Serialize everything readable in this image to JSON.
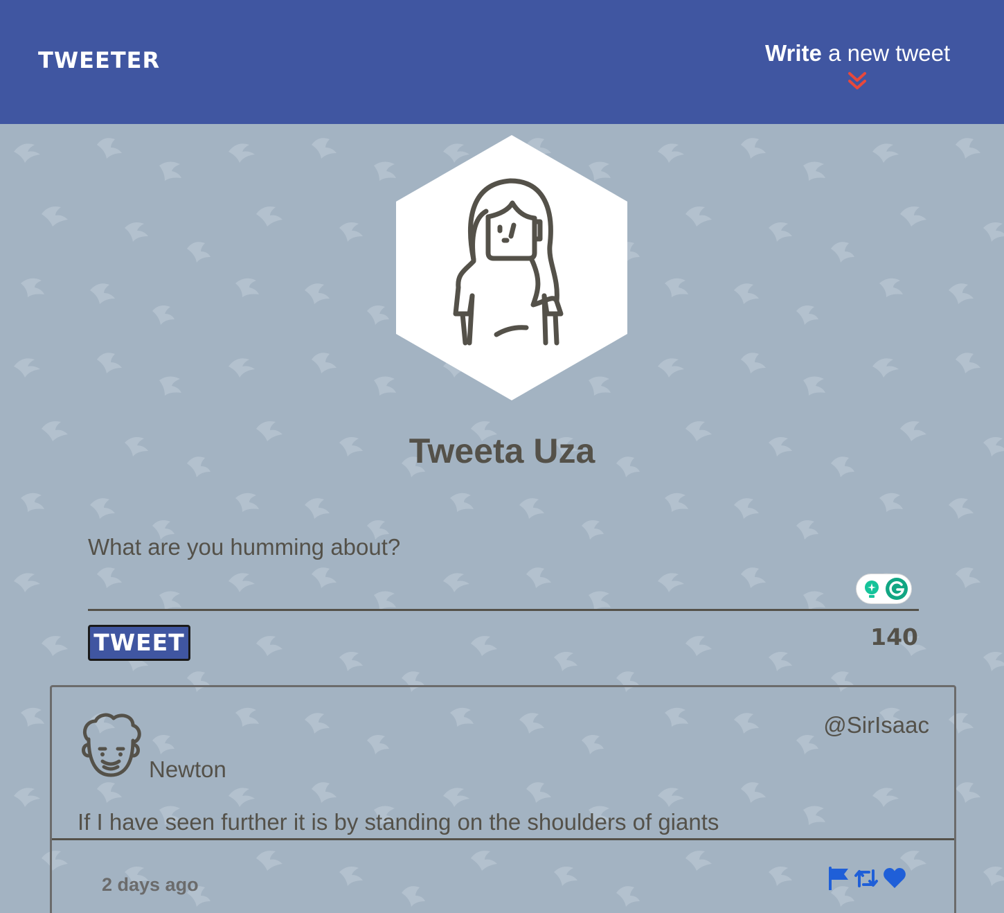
{
  "nav": {
    "brand": "TWEETER",
    "compose_strong": "Write",
    "compose_light": " a new tweet"
  },
  "profile": {
    "name": "Tweeta Uza"
  },
  "compose": {
    "placeholder": "What are you humming about?",
    "button_label": "TWEET",
    "counter": "140"
  },
  "tweet": {
    "name": "Newton",
    "handle": "@SirIsaac",
    "body": "If I have seen further it is by standing on the shoulders of giants",
    "time": "2 days ago",
    "actions": [
      "flag-icon",
      "retweet-icon",
      "heart-icon"
    ]
  },
  "colors": {
    "nav_bg": "#4056a1",
    "page_bg": "#a3b3c2",
    "text": "#545149",
    "accent_red": "#e8483b",
    "action_blue": "#1f5fd8"
  }
}
